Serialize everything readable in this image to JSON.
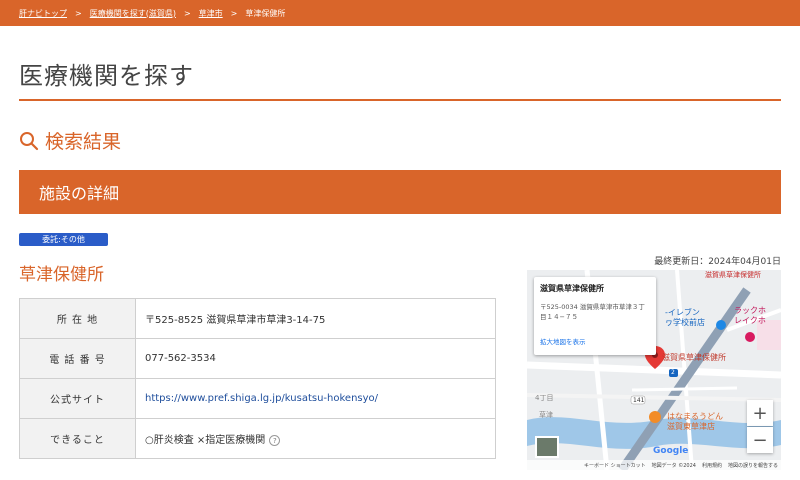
{
  "breadcrumb": {
    "items": [
      "肝ナビトップ",
      "医療機関を探す(滋賀県)",
      "草津市",
      "草津保健所"
    ],
    "separator": ">"
  },
  "page_title": "医療機関を探す",
  "results_heading": "検索結果",
  "section_band": "施設の詳細",
  "tag": "委託:その他",
  "last_updated": "最終更新日：2024年04月01日",
  "facility_name": "草津保健所",
  "info_table": {
    "rows": [
      {
        "key": "所 在 地",
        "value": "〒525-8525 滋賀県草津市草津3-14-75"
      },
      {
        "key": "電 話 番 号",
        "value": "077-562-3534"
      },
      {
        "key": "公式サイト",
        "value": "https://www.pref.shiga.lg.jp/kusatsu-hokensyo/"
      },
      {
        "key": "できること",
        "value": "○肝炎検査 ×指定医療機関"
      }
    ]
  },
  "map": {
    "card_name": "滋賀県草津保健所",
    "card_address": "〒525-0034 滋賀県草津市草津３丁目１４−７５",
    "card_link": "拡大地図を表示",
    "pin_label": "滋賀県草津保健所",
    "poi_udon": [
      "はなまるうどん",
      "滋賀東草津店"
    ],
    "poi_lucky": [
      "ラックホ",
      "レイクホ"
    ],
    "poi_711": [
      "-イレブン",
      "ヮ学校前店"
    ],
    "top_label": "滋賀県草津保健所",
    "road_141": "141",
    "road_2": "2",
    "label_4chome": "4丁目",
    "label_kusatsu": "草津",
    "google": "Google",
    "footer": [
      "キーボード ショートカット",
      "地図データ ©2024",
      "利用規約",
      "地図の誤りを報告する"
    ],
    "zoom_in": "+",
    "zoom_out": "−"
  },
  "colors": {
    "accent": "#d9652a",
    "tag": "#2a5cc8",
    "link": "#1f4e9c"
  }
}
